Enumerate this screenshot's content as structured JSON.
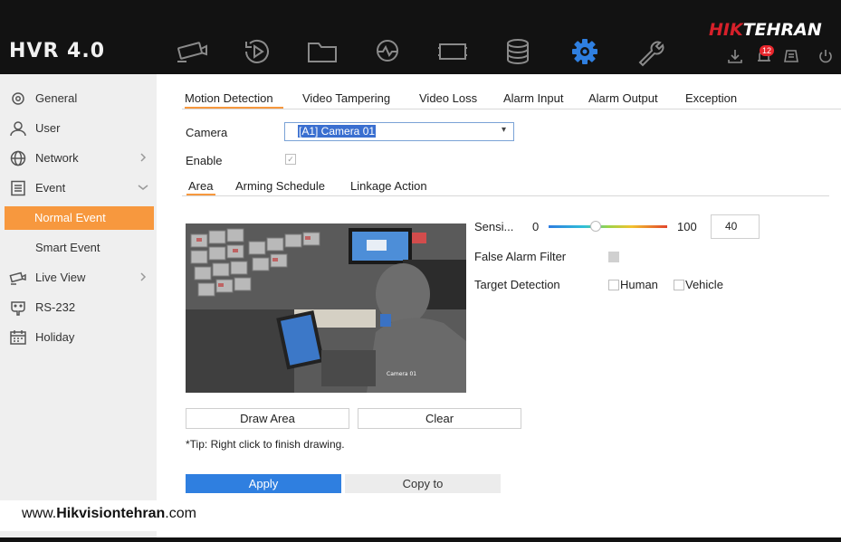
{
  "app": {
    "logo": "HVR 4.0",
    "brand_red": "HIK",
    "brand_white": "TEHRAN",
    "alarm_count": "12",
    "nav_icons": [
      "camera-icon",
      "playback-icon",
      "folder-icon",
      "analytics-icon",
      "vca-icon",
      "storage-icon",
      "settings-icon",
      "maintenance-icon"
    ],
    "util_icons": [
      "download-icon",
      "alarm-bell-icon",
      "tasks-icon",
      "power-icon"
    ]
  },
  "sidebar": {
    "items": [
      {
        "label": "General",
        "icon": "gear-icon"
      },
      {
        "label": "User",
        "icon": "user-icon"
      },
      {
        "label": "Network",
        "icon": "globe-icon"
      },
      {
        "label": "Event",
        "icon": "event-list-icon"
      },
      {
        "label": "Normal Event"
      },
      {
        "label": "Smart Event"
      },
      {
        "label": "Live View",
        "icon": "camera-icon"
      },
      {
        "label": "RS-232",
        "icon": "serial-icon"
      },
      {
        "label": "Holiday",
        "icon": "calendar-icon"
      }
    ],
    "active": "Normal Event"
  },
  "tabs": [
    "Motion Detection",
    "Video Tampering",
    "Video Loss",
    "Alarm Input",
    "Alarm Output",
    "Exception"
  ],
  "active_tab": "Motion Detection",
  "form": {
    "camera_label": "Camera",
    "camera_value": "[A1] Camera 01",
    "enable_label": "Enable",
    "enable_checked": true
  },
  "subtabs": [
    "Area",
    "Arming Schedule",
    "Linkage Action"
  ],
  "active_subtab": "Area",
  "sensitivity": {
    "label": "Sensi...",
    "min": "0",
    "max": "100",
    "value": "40",
    "level": 0.4
  },
  "false_alarm_label": "False Alarm Filter",
  "target_detection": {
    "label": "Target Detection",
    "human": "Human",
    "vehicle": "Vehicle"
  },
  "buttons": {
    "draw_area": "Draw Area",
    "clear": "Clear",
    "apply": "Apply",
    "copy_to": "Copy to"
  },
  "tip": "*Tip: Right click to finish drawing.",
  "watermark": {
    "prefix": "www.",
    "name": "Hikvisiontehran",
    "suffix": ".com"
  },
  "colors": {
    "accent": "#f7983e",
    "primary": "#2f7fe0",
    "brand_red": "#d6202a",
    "topbar": "#121212"
  }
}
